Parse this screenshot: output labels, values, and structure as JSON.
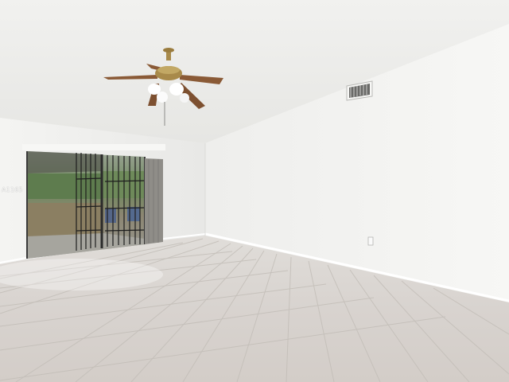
{
  "image": {
    "description_tags": [
      "empty-room",
      "ceiling-fan",
      "sliding-glass-door",
      "tile-floor",
      "air-vent",
      "wall-outlet"
    ],
    "watermark": "A1165"
  },
  "colors": {
    "wall": "#f2f2f0",
    "wall_shadow": "#e4e4e1",
    "ceiling": "#ececea",
    "floor": "#d9d5d1",
    "grout": "#c4bfba",
    "wood": "#8a5a36",
    "brass": "#a88a4a",
    "curtain": "#8f8d88"
  }
}
